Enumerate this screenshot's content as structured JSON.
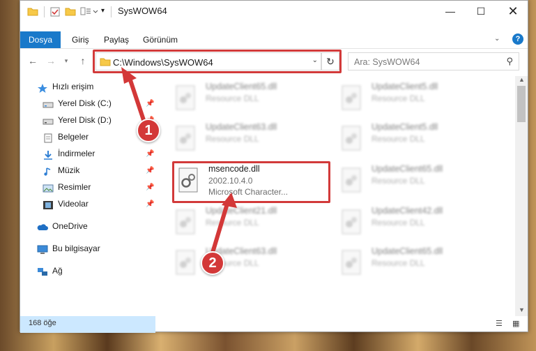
{
  "window": {
    "title": "SysWOW64"
  },
  "ribbon": {
    "tabs": [
      "Dosya",
      "Giriş",
      "Paylaş",
      "Görünüm"
    ]
  },
  "address": {
    "path": "C:\\Windows\\SysWOW64"
  },
  "search": {
    "placeholder": "Ara: SysWOW64"
  },
  "sidebar": {
    "items": [
      {
        "label": "Hızlı erişim",
        "icon": "star-icon"
      },
      {
        "label": "Yerel Disk (C:)",
        "icon": "drive-icon"
      },
      {
        "label": "Yerel Disk (D:)",
        "icon": "drive-icon"
      },
      {
        "label": "Belgeler",
        "icon": "document-icon"
      },
      {
        "label": "İndirmeler",
        "icon": "download-icon"
      },
      {
        "label": "Müzik",
        "icon": "music-icon"
      },
      {
        "label": "Resimler",
        "icon": "pictures-icon"
      },
      {
        "label": "Videolar",
        "icon": "video-icon"
      },
      {
        "label": "OneDrive",
        "icon": "cloud-icon"
      },
      {
        "label": "Bu bilgisayar",
        "icon": "computer-icon"
      },
      {
        "label": "Ağ",
        "icon": "network-icon"
      }
    ]
  },
  "files": {
    "highlighted": {
      "name": "msencode.dll",
      "version": "2002.10.4.0",
      "description": "Microsoft Character..."
    },
    "left_column": [
      {
        "name": "UpdateClient65.dll",
        "type": "Resource DLL"
      },
      {
        "name": "UpdateClient63.dll",
        "type": "Resource DLL"
      },
      {
        "name": "UpdateClient21.dll",
        "type": "Resource DLL"
      },
      {
        "name": "UpdateClient63.dll",
        "type": "Resource DLL"
      }
    ],
    "right_column": [
      {
        "name": "UpdateClient5.dll",
        "type": "Resource DLL"
      },
      {
        "name": "UpdateClient5.dll",
        "type": "Resource DLL"
      },
      {
        "name": "UpdateClient65.dll",
        "type": "Resource DLL"
      },
      {
        "name": "UpdateClient42.dll",
        "type": "Resource DLL"
      },
      {
        "name": "UpdateClient65.dll",
        "type": "Resource DLL"
      }
    ]
  },
  "status": {
    "count": "168 öğe"
  },
  "markers": [
    "1",
    "2"
  ],
  "colors": {
    "accent": "#1979ca",
    "highlight": "#d23a3a",
    "selected": "#cce8ff"
  }
}
